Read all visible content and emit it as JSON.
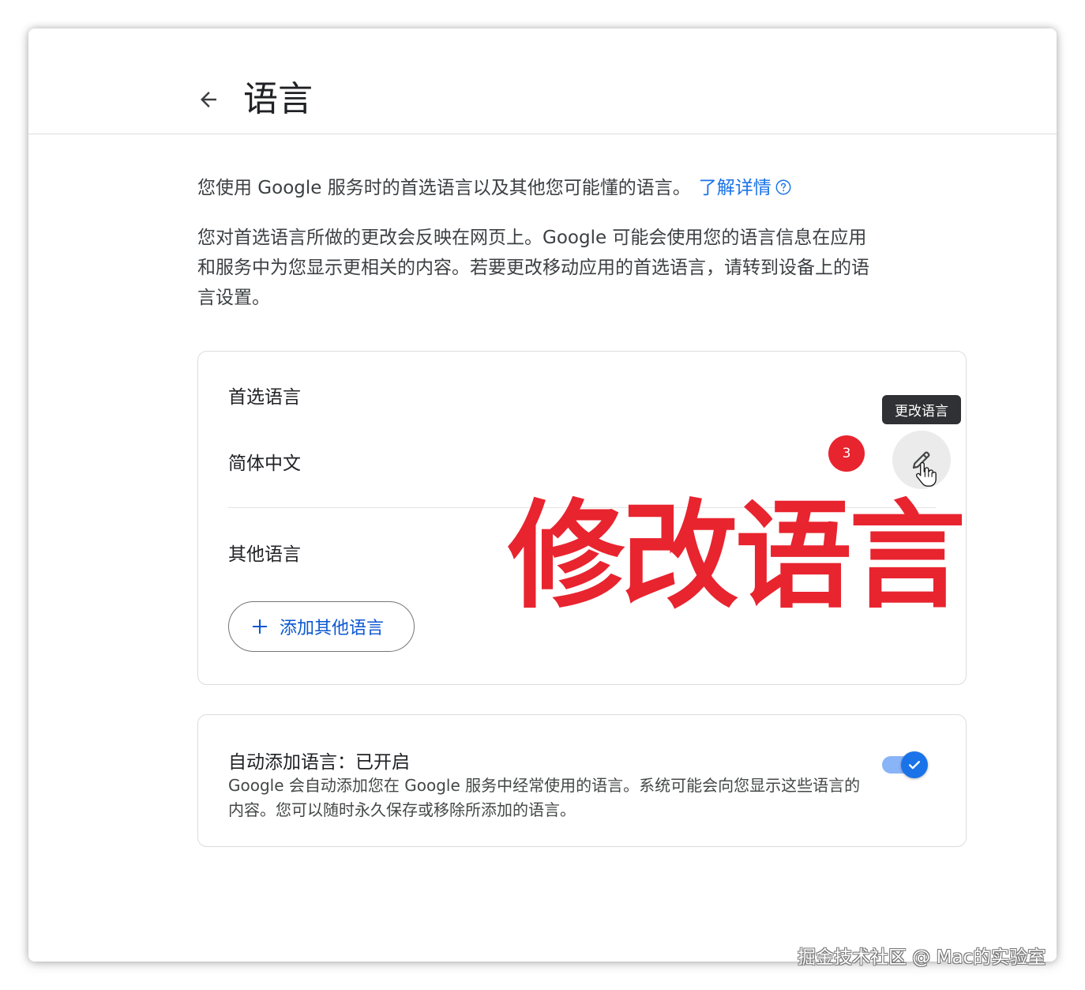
{
  "header": {
    "title": "语言"
  },
  "intro": {
    "text": "您使用 Google 服务时的首选语言以及其他您可能懂的语言。",
    "learn_more": "了解详情"
  },
  "notice": {
    "text": "您对首选语言所做的更改会反映在网页上。Google 可能会使用您的语言信息在应用和服务中为您显示更相关的内容。若要更改移动应用的首选语言，请转到设备上的语言设置。"
  },
  "preferred": {
    "label": "首选语言",
    "value": "简体中文",
    "step_badge": "3",
    "edit_tooltip": "更改语言"
  },
  "other": {
    "label": "其他语言",
    "add_button": "添加其他语言"
  },
  "overlay_annotation": "修改语言",
  "auto_add": {
    "title": "自动添加语言：已开启",
    "description": "Google 会自动添加您在 Google 服务中经常使用的语言。系统可能会向您显示这些语言的内容。您可以随时永久保存或移除所添加的语言。",
    "enabled": true
  },
  "watermark": "掘金技术社区 @ Mac的实验室",
  "colors": {
    "accent": "#1a73e8",
    "link": "#0b57d0",
    "annotation_red": "#e8242f"
  },
  "icons": {
    "back": "arrow-back-icon",
    "help": "help-circle-icon",
    "edit": "pencil-icon",
    "cursor": "hand-pointer-icon",
    "add": "plus-icon",
    "check": "check-icon"
  }
}
